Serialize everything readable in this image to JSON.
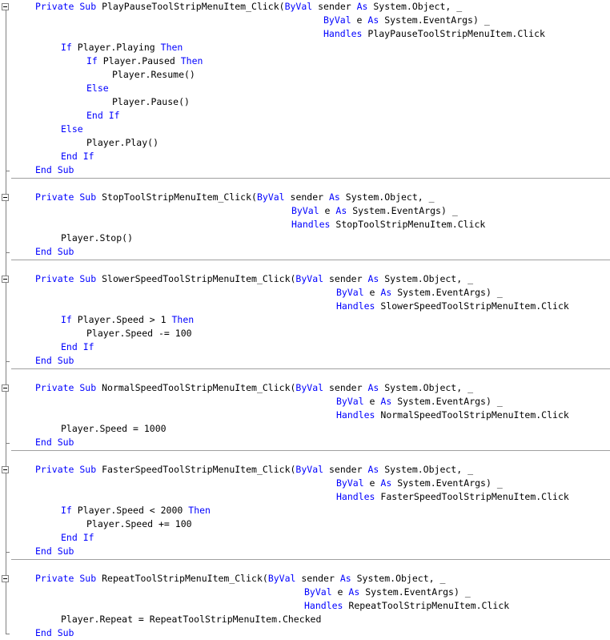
{
  "colors": {
    "keyword": "#0000ff",
    "text": "#000000",
    "background": "#ffffff",
    "separator": "#a0a0a0",
    "outline": "#808080"
  },
  "margin": {
    "collapse_icon": "minus-box-icon"
  },
  "methods": [
    {
      "name": "PlayPauseToolStripMenuItem_Click",
      "lines": [
        {
          "indent": 44,
          "tokens": [
            {
              "t": "Private Sub",
              "k": true
            },
            {
              "t": " PlayPauseToolStripMenuItem_Click(",
              "k": false
            },
            {
              "t": "ByVal",
              "k": true
            },
            {
              "t": " sender ",
              "k": false
            },
            {
              "t": "As",
              "k": true
            },
            {
              "t": " System.Object, _",
              "k": false
            }
          ]
        },
        {
          "indent": 404,
          "tokens": [
            {
              "t": "ByVal",
              "k": true
            },
            {
              "t": " e ",
              "k": false
            },
            {
              "t": "As",
              "k": true
            },
            {
              "t": " System.EventArgs) _",
              "k": false
            }
          ]
        },
        {
          "indent": 404,
          "tokens": [
            {
              "t": "Handles",
              "k": true
            },
            {
              "t": " PlayPauseToolStripMenuItem.Click",
              "k": false
            }
          ]
        },
        {
          "indent": 76,
          "tokens": [
            {
              "t": "If",
              "k": true
            },
            {
              "t": " Player.Playing ",
              "k": false
            },
            {
              "t": "Then",
              "k": true
            }
          ]
        },
        {
          "indent": 108,
          "tokens": [
            {
              "t": "If",
              "k": true
            },
            {
              "t": " Player.Paused ",
              "k": false
            },
            {
              "t": "Then",
              "k": true
            }
          ]
        },
        {
          "indent": 140,
          "tokens": [
            {
              "t": "Player.Resume()",
              "k": false
            }
          ]
        },
        {
          "indent": 108,
          "tokens": [
            {
              "t": "Else",
              "k": true
            }
          ]
        },
        {
          "indent": 140,
          "tokens": [
            {
              "t": "Player.Pause()",
              "k": false
            }
          ]
        },
        {
          "indent": 108,
          "tokens": [
            {
              "t": "End If",
              "k": true
            }
          ]
        },
        {
          "indent": 76,
          "tokens": [
            {
              "t": "Else",
              "k": true
            }
          ]
        },
        {
          "indent": 108,
          "tokens": [
            {
              "t": "Player.Play()",
              "k": false
            }
          ]
        },
        {
          "indent": 76,
          "tokens": [
            {
              "t": "End If",
              "k": true
            }
          ]
        },
        {
          "indent": 44,
          "tokens": [
            {
              "t": "End Sub",
              "k": true
            }
          ]
        }
      ]
    },
    {
      "name": "StopToolStripMenuItem_Click",
      "lines": [
        {
          "indent": 44,
          "tokens": [
            {
              "t": "Private Sub",
              "k": true
            },
            {
              "t": " StopToolStripMenuItem_Click(",
              "k": false
            },
            {
              "t": "ByVal",
              "k": true
            },
            {
              "t": " sender ",
              "k": false
            },
            {
              "t": "As",
              "k": true
            },
            {
              "t": " System.Object, _",
              "k": false
            }
          ]
        },
        {
          "indent": 364,
          "tokens": [
            {
              "t": "ByVal",
              "k": true
            },
            {
              "t": " e ",
              "k": false
            },
            {
              "t": "As",
              "k": true
            },
            {
              "t": " System.EventArgs) _",
              "k": false
            }
          ]
        },
        {
          "indent": 364,
          "tokens": [
            {
              "t": "Handles",
              "k": true
            },
            {
              "t": " StopToolStripMenuItem.Click",
              "k": false
            }
          ]
        },
        {
          "indent": 76,
          "tokens": [
            {
              "t": "Player.Stop()",
              "k": false
            }
          ]
        },
        {
          "indent": 44,
          "tokens": [
            {
              "t": "End Sub",
              "k": true
            }
          ]
        }
      ]
    },
    {
      "name": "SlowerSpeedToolStripMenuItem_Click",
      "lines": [
        {
          "indent": 44,
          "tokens": [
            {
              "t": "Private Sub",
              "k": true
            },
            {
              "t": " SlowerSpeedToolStripMenuItem_Click(",
              "k": false
            },
            {
              "t": "ByVal",
              "k": true
            },
            {
              "t": " sender ",
              "k": false
            },
            {
              "t": "As",
              "k": true
            },
            {
              "t": " System.Object, _",
              "k": false
            }
          ]
        },
        {
          "indent": 420,
          "tokens": [
            {
              "t": "ByVal",
              "k": true
            },
            {
              "t": " e ",
              "k": false
            },
            {
              "t": "As",
              "k": true
            },
            {
              "t": " System.EventArgs) _",
              "k": false
            }
          ]
        },
        {
          "indent": 420,
          "tokens": [
            {
              "t": "Handles",
              "k": true
            },
            {
              "t": " SlowerSpeedToolStripMenuItem.Click",
              "k": false
            }
          ]
        },
        {
          "indent": 76,
          "tokens": [
            {
              "t": "If",
              "k": true
            },
            {
              "t": " Player.Speed > 1 ",
              "k": false
            },
            {
              "t": "Then",
              "k": true
            }
          ]
        },
        {
          "indent": 108,
          "tokens": [
            {
              "t": "Player.Speed -= 100",
              "k": false
            }
          ]
        },
        {
          "indent": 76,
          "tokens": [
            {
              "t": "End If",
              "k": true
            }
          ]
        },
        {
          "indent": 44,
          "tokens": [
            {
              "t": "End Sub",
              "k": true
            }
          ]
        }
      ]
    },
    {
      "name": "NormalSpeedToolStripMenuItem_Click",
      "lines": [
        {
          "indent": 44,
          "tokens": [
            {
              "t": "Private Sub",
              "k": true
            },
            {
              "t": " NormalSpeedToolStripMenuItem_Click(",
              "k": false
            },
            {
              "t": "ByVal",
              "k": true
            },
            {
              "t": " sender ",
              "k": false
            },
            {
              "t": "As",
              "k": true
            },
            {
              "t": " System.Object, _",
              "k": false
            }
          ]
        },
        {
          "indent": 420,
          "tokens": [
            {
              "t": "ByVal",
              "k": true
            },
            {
              "t": " e ",
              "k": false
            },
            {
              "t": "As",
              "k": true
            },
            {
              "t": " System.EventArgs) _",
              "k": false
            }
          ]
        },
        {
          "indent": 420,
          "tokens": [
            {
              "t": "Handles",
              "k": true
            },
            {
              "t": " NormalSpeedToolStripMenuItem.Click",
              "k": false
            }
          ]
        },
        {
          "indent": 76,
          "tokens": [
            {
              "t": "Player.Speed = 1000",
              "k": false
            }
          ]
        },
        {
          "indent": 44,
          "tokens": [
            {
              "t": "End Sub",
              "k": true
            }
          ]
        }
      ]
    },
    {
      "name": "FasterSpeedToolStripMenuItem_Click",
      "lines": [
        {
          "indent": 44,
          "tokens": [
            {
              "t": "Private Sub",
              "k": true
            },
            {
              "t": " FasterSpeedToolStripMenuItem_Click(",
              "k": false
            },
            {
              "t": "ByVal",
              "k": true
            },
            {
              "t": " sender ",
              "k": false
            },
            {
              "t": "As",
              "k": true
            },
            {
              "t": " System.Object, _",
              "k": false
            }
          ]
        },
        {
          "indent": 420,
          "tokens": [
            {
              "t": "ByVal",
              "k": true
            },
            {
              "t": " e ",
              "k": false
            },
            {
              "t": "As",
              "k": true
            },
            {
              "t": " System.EventArgs) _",
              "k": false
            }
          ]
        },
        {
          "indent": 420,
          "tokens": [
            {
              "t": "Handles",
              "k": true
            },
            {
              "t": " FasterSpeedToolStripMenuItem.Click",
              "k": false
            }
          ]
        },
        {
          "indent": 76,
          "tokens": [
            {
              "t": "If",
              "k": true
            },
            {
              "t": " Player.Speed < 2000 ",
              "k": false
            },
            {
              "t": "Then",
              "k": true
            }
          ]
        },
        {
          "indent": 108,
          "tokens": [
            {
              "t": "Player.Speed += 100",
              "k": false
            }
          ]
        },
        {
          "indent": 76,
          "tokens": [
            {
              "t": "End If",
              "k": true
            }
          ]
        },
        {
          "indent": 44,
          "tokens": [
            {
              "t": "End Sub",
              "k": true
            }
          ]
        }
      ]
    },
    {
      "name": "RepeatToolStripMenuItem_Click",
      "lines": [
        {
          "indent": 44,
          "tokens": [
            {
              "t": "Private Sub",
              "k": true
            },
            {
              "t": " RepeatToolStripMenuItem_Click(",
              "k": false
            },
            {
              "t": "ByVal",
              "k": true
            },
            {
              "t": " sender ",
              "k": false
            },
            {
              "t": "As",
              "k": true
            },
            {
              "t": " System.Object, _",
              "k": false
            }
          ]
        },
        {
          "indent": 380,
          "tokens": [
            {
              "t": "ByVal",
              "k": true
            },
            {
              "t": " e ",
              "k": false
            },
            {
              "t": "As",
              "k": true
            },
            {
              "t": " System.EventArgs) _",
              "k": false
            }
          ]
        },
        {
          "indent": 380,
          "tokens": [
            {
              "t": "Handles",
              "k": true
            },
            {
              "t": " RepeatToolStripMenuItem.Click",
              "k": false
            }
          ]
        },
        {
          "indent": 76,
          "tokens": [
            {
              "t": "Player.Repeat = RepeatToolStripMenuItem.Checked",
              "k": false
            }
          ]
        },
        {
          "indent": 44,
          "tokens": [
            {
              "t": "End Sub",
              "k": true
            }
          ]
        }
      ]
    }
  ]
}
